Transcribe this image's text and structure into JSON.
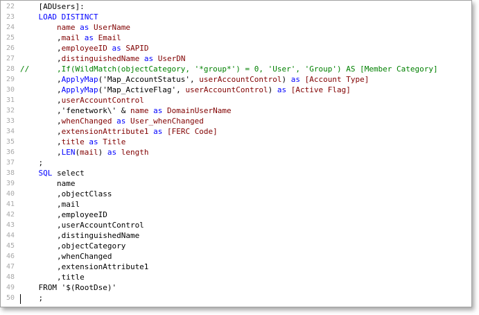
{
  "editor": {
    "lines": [
      {
        "n": "22",
        "segs": [
          {
            "c": "plain",
            "t": "    [ADUsers]:"
          }
        ]
      },
      {
        "n": "23",
        "segs": [
          {
            "c": "plain",
            "t": "    "
          },
          {
            "c": "kw",
            "t": "LOAD"
          },
          {
            "c": "plain",
            "t": " "
          },
          {
            "c": "kw",
            "t": "DISTINCT"
          }
        ]
      },
      {
        "n": "24",
        "segs": [
          {
            "c": "plain",
            "t": "        "
          },
          {
            "c": "fld",
            "t": "name"
          },
          {
            "c": "plain",
            "t": " "
          },
          {
            "c": "kw",
            "t": "as"
          },
          {
            "c": "plain",
            "t": " "
          },
          {
            "c": "fld",
            "t": "UserName"
          }
        ]
      },
      {
        "n": "25",
        "segs": [
          {
            "c": "plain",
            "t": "        ,"
          },
          {
            "c": "fld",
            "t": "mail"
          },
          {
            "c": "plain",
            "t": " "
          },
          {
            "c": "kw",
            "t": "as"
          },
          {
            "c": "plain",
            "t": " "
          },
          {
            "c": "fld",
            "t": "Email"
          }
        ]
      },
      {
        "n": "26",
        "segs": [
          {
            "c": "plain",
            "t": "        ,"
          },
          {
            "c": "fld",
            "t": "employeeID"
          },
          {
            "c": "plain",
            "t": " "
          },
          {
            "c": "kw",
            "t": "as"
          },
          {
            "c": "plain",
            "t": " "
          },
          {
            "c": "fld",
            "t": "SAPID"
          }
        ]
      },
      {
        "n": "27",
        "segs": [
          {
            "c": "plain",
            "t": "        ,"
          },
          {
            "c": "fld",
            "t": "distinguishedName"
          },
          {
            "c": "plain",
            "t": " "
          },
          {
            "c": "kw",
            "t": "as"
          },
          {
            "c": "plain",
            "t": " "
          },
          {
            "c": "fld",
            "t": "UserDN"
          }
        ]
      },
      {
        "n": "28",
        "segs": [
          {
            "c": "cm",
            "t": "//      ,If(WildMatch(objectCategory, '*group*') = 0, 'User', 'Group') AS [Member Category]"
          }
        ]
      },
      {
        "n": "29",
        "segs": [
          {
            "c": "plain",
            "t": "        ,"
          },
          {
            "c": "fn",
            "t": "ApplyMap"
          },
          {
            "c": "plain",
            "t": "('Map_AccountStatus', "
          },
          {
            "c": "fld",
            "t": "userAccountControl"
          },
          {
            "c": "plain",
            "t": ") "
          },
          {
            "c": "kw",
            "t": "as"
          },
          {
            "c": "plain",
            "t": " "
          },
          {
            "c": "fld",
            "t": "[Account Type]"
          }
        ]
      },
      {
        "n": "30",
        "segs": [
          {
            "c": "plain",
            "t": "        ,"
          },
          {
            "c": "fn",
            "t": "ApplyMap"
          },
          {
            "c": "plain",
            "t": "('Map_ActiveFlag', "
          },
          {
            "c": "fld",
            "t": "userAccountControl"
          },
          {
            "c": "plain",
            "t": ") "
          },
          {
            "c": "kw",
            "t": "as"
          },
          {
            "c": "plain",
            "t": " "
          },
          {
            "c": "fld",
            "t": "[Active Flag]"
          }
        ]
      },
      {
        "n": "31",
        "segs": [
          {
            "c": "plain",
            "t": "        ,"
          },
          {
            "c": "fld",
            "t": "userAccountControl"
          }
        ]
      },
      {
        "n": "32",
        "segs": [
          {
            "c": "plain",
            "t": "        ,'fenetwork\\' & "
          },
          {
            "c": "fld",
            "t": "name"
          },
          {
            "c": "plain",
            "t": " "
          },
          {
            "c": "kw",
            "t": "as"
          },
          {
            "c": "plain",
            "t": " "
          },
          {
            "c": "fld",
            "t": "DomainUserName"
          }
        ]
      },
      {
        "n": "33",
        "segs": [
          {
            "c": "plain",
            "t": "        ,"
          },
          {
            "c": "fld",
            "t": "whenChanged"
          },
          {
            "c": "plain",
            "t": " "
          },
          {
            "c": "kw",
            "t": "as"
          },
          {
            "c": "plain",
            "t": " "
          },
          {
            "c": "fld",
            "t": "User_whenChanged"
          }
        ]
      },
      {
        "n": "34",
        "segs": [
          {
            "c": "plain",
            "t": "        ,"
          },
          {
            "c": "fld",
            "t": "extensionAttribute1"
          },
          {
            "c": "plain",
            "t": " "
          },
          {
            "c": "kw",
            "t": "as"
          },
          {
            "c": "plain",
            "t": " "
          },
          {
            "c": "fld",
            "t": "[FERC Code]"
          }
        ]
      },
      {
        "n": "35",
        "segs": [
          {
            "c": "plain",
            "t": "        ,"
          },
          {
            "c": "fld",
            "t": "title"
          },
          {
            "c": "plain",
            "t": " "
          },
          {
            "c": "kw",
            "t": "as"
          },
          {
            "c": "plain",
            "t": " "
          },
          {
            "c": "fld",
            "t": "Title"
          }
        ]
      },
      {
        "n": "36",
        "segs": [
          {
            "c": "plain",
            "t": "        ,"
          },
          {
            "c": "fn",
            "t": "LEN"
          },
          {
            "c": "plain",
            "t": "("
          },
          {
            "c": "fld",
            "t": "mail"
          },
          {
            "c": "plain",
            "t": ") "
          },
          {
            "c": "kw",
            "t": "as"
          },
          {
            "c": "plain",
            "t": " "
          },
          {
            "c": "fld",
            "t": "length"
          }
        ]
      },
      {
        "n": "37",
        "segs": [
          {
            "c": "plain",
            "t": "    ;"
          }
        ]
      },
      {
        "n": "38",
        "segs": [
          {
            "c": "plain",
            "t": "    "
          },
          {
            "c": "kw",
            "t": "SQL"
          },
          {
            "c": "plain",
            "t": " select"
          }
        ]
      },
      {
        "n": "39",
        "segs": [
          {
            "c": "plain",
            "t": "        name"
          }
        ]
      },
      {
        "n": "40",
        "segs": [
          {
            "c": "plain",
            "t": "        ,objectClass"
          }
        ]
      },
      {
        "n": "41",
        "segs": [
          {
            "c": "plain",
            "t": "        ,mail"
          }
        ]
      },
      {
        "n": "42",
        "segs": [
          {
            "c": "plain",
            "t": "        ,employeeID"
          }
        ]
      },
      {
        "n": "43",
        "segs": [
          {
            "c": "plain",
            "t": "        ,userAccountControl"
          }
        ]
      },
      {
        "n": "44",
        "segs": [
          {
            "c": "plain",
            "t": "        ,distinguishedName"
          }
        ]
      },
      {
        "n": "45",
        "segs": [
          {
            "c": "plain",
            "t": "        ,objectCategory"
          }
        ]
      },
      {
        "n": "46",
        "segs": [
          {
            "c": "plain",
            "t": "        ,whenChanged"
          }
        ]
      },
      {
        "n": "47",
        "segs": [
          {
            "c": "plain",
            "t": "        ,extensionAttribute1"
          }
        ]
      },
      {
        "n": "48",
        "segs": [
          {
            "c": "plain",
            "t": "        ,title"
          }
        ]
      },
      {
        "n": "49",
        "segs": [
          {
            "c": "plain",
            "t": "    FROM '$(RootDse)'"
          }
        ]
      },
      {
        "n": "50",
        "segs": [
          {
            "c": "plain",
            "t": "    ;"
          }
        ]
      }
    ]
  }
}
